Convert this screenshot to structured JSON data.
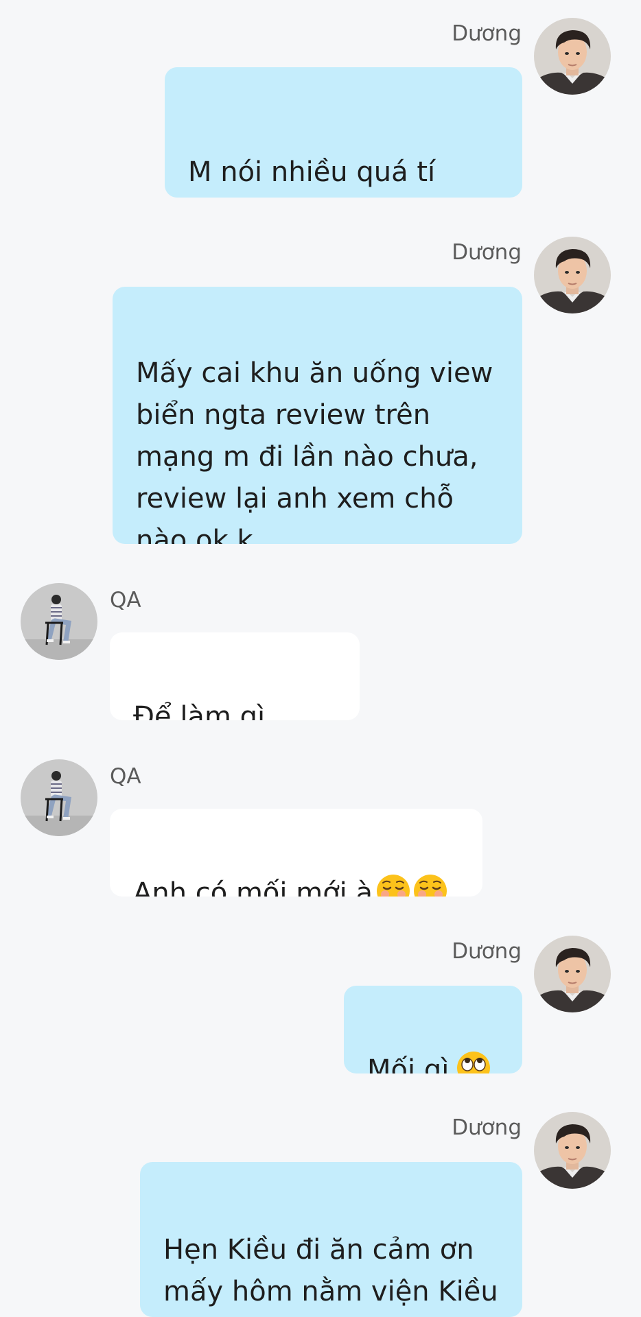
{
  "participants": {
    "duong": {
      "name": "Dương"
    },
    "qa": {
      "name": "QA"
    }
  },
  "messages": [
    {
      "sender": "Dương",
      "text": "M nói nhiều quá tí\nanh quên"
    },
    {
      "sender": "Dương",
      "text": "Mấy cai khu ăn uống view\nbiển ngta review trên\nmạng m đi lần nào chưa,\nreview lại anh xem chỗ\nnào ok k"
    },
    {
      "sender": "QA",
      "text": "Để làm gì anh?"
    },
    {
      "sender": "QA",
      "text": "Anh có mối mới à",
      "emoji": [
        "smiling-face-icon",
        "smiling-face-icon"
      ]
    },
    {
      "sender": "Dương",
      "text": "Mối gì",
      "emoji": [
        "eye-roll-face-icon"
      ]
    },
    {
      "sender": "Dương",
      "text": "Hẹn Kiều đi ăn cảm ơn\nmấy hôm nằm viện Kiều\nhay qua an ủi"
    }
  ],
  "colors": {
    "background": "#f6f7f9",
    "outgoing_bubble": "#c5edfc",
    "incoming_bubble": "#ffffff",
    "sender_name": "#5b5b5b",
    "message_text": "#1e1e1e"
  }
}
